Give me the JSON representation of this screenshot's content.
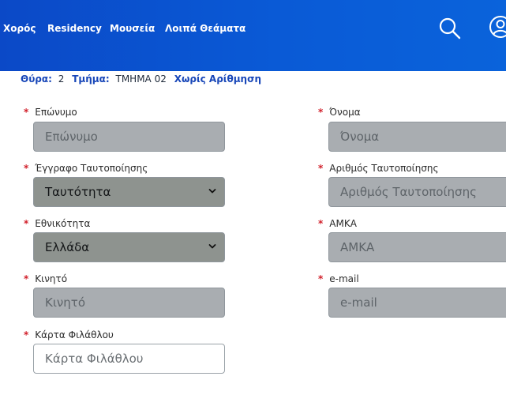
{
  "nav": {
    "items": [
      "Χορός",
      "Residency",
      "Μουσεία",
      "Λοιπά Θεάματα"
    ],
    "icons": [
      "search-icon",
      "user-icon"
    ]
  },
  "seat": {
    "gate_label": "Θύρα:",
    "gate_value": "2",
    "section_label": "Τμήμα:",
    "section_value": "ΤΜΗΜΑ 02",
    "seating_text": "Χωρίς Αρίθμηση"
  },
  "form": {
    "required_mark": "*",
    "surname": {
      "label": "Επώνυμο",
      "placeholder": "Επώνυμο"
    },
    "name": {
      "label": "Όνομα",
      "placeholder": "Όνομα"
    },
    "id_doc": {
      "label": "Έγγραφο Ταυτοποίησης",
      "value": "Ταυτότητα"
    },
    "id_number": {
      "label": "Αριθμός Ταυτοποίησης",
      "placeholder": "Αριθμός Ταυτοποίησης"
    },
    "nationality": {
      "label": "Εθνικότητα",
      "value": "Ελλάδα"
    },
    "amka": {
      "label": "ΑΜΚΑ",
      "placeholder": "ΑΜΚΑ"
    },
    "mobile": {
      "label": "Κινητό",
      "placeholder": "Κινητό"
    },
    "email": {
      "label": "e-mail",
      "placeholder": "e-mail"
    },
    "fan_card": {
      "label": "Κάρτα Φιλάθλου",
      "placeholder": "Κάρτα Φιλάθλου"
    }
  },
  "colors": {
    "header_blue": "#0b49c7",
    "accent_blue": "#1746b8",
    "required_red": "#d11f2a"
  }
}
